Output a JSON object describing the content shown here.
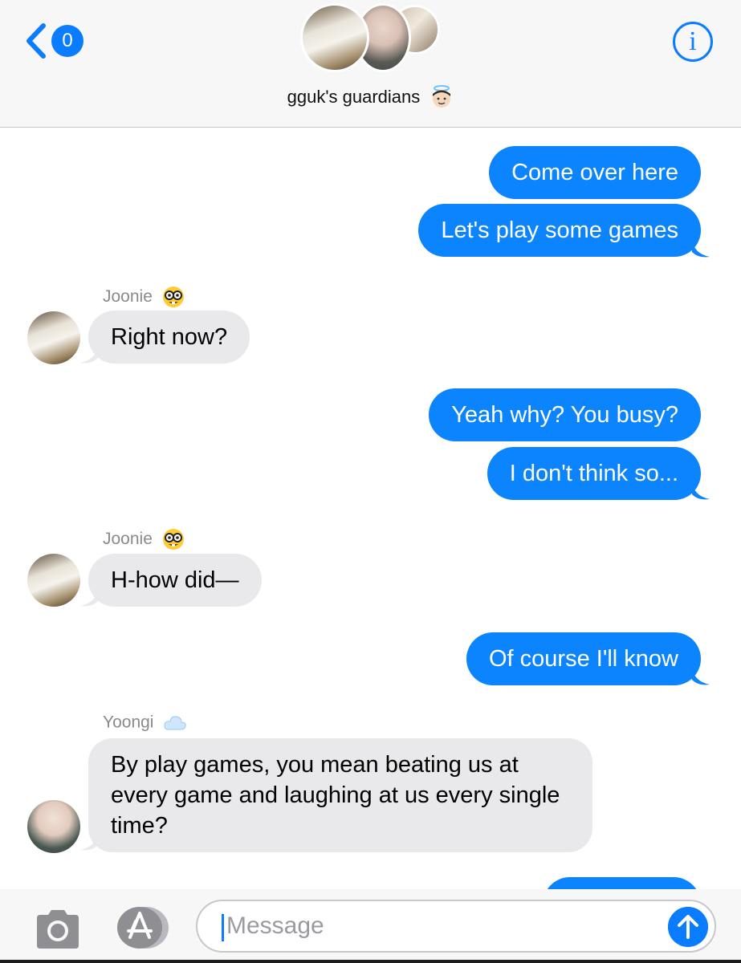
{
  "header": {
    "back_badge": "0",
    "group_name": "gguk's guardians",
    "info_glyph": "i"
  },
  "messages": [
    {
      "from": "me",
      "text": "Come over here"
    },
    {
      "from": "me",
      "text": "Let's play some games"
    },
    {
      "from": "Joonie",
      "text": "Right now?"
    },
    {
      "from": "me",
      "text": "Yeah why? You busy?"
    },
    {
      "from": "me",
      "text": "I don't think so..."
    },
    {
      "from": "Joonie",
      "text": "H-how did—"
    },
    {
      "from": "me",
      "text": "Of course I'll know"
    },
    {
      "from": "Yoongi",
      "lines": [
        "By play games, you mean beating us at",
        "every game and laughing at us every single",
        "time?"
      ]
    }
  ],
  "senders": {
    "joonie": "Joonie",
    "yoongi": "Yoongi"
  },
  "composer": {
    "placeholder": "Message"
  },
  "colors": {
    "accent": "#0a7cff",
    "outgoing_bubble": "#0b84fe",
    "incoming_bubble": "#e9e9eb"
  },
  "icons": [
    "back-chevron-icon",
    "info-icon",
    "camera-icon",
    "app-store-icon",
    "send-arrow-icon",
    "nerd-face-emoji",
    "angel-emoji",
    "cloud-emoji"
  ]
}
